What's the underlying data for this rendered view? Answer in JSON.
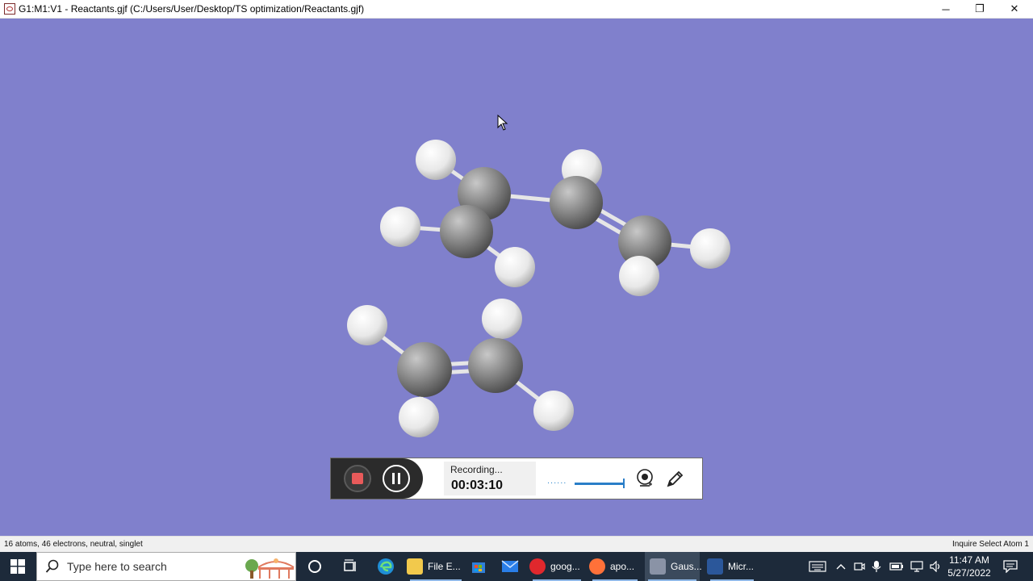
{
  "window": {
    "title": "G1:M1:V1 - Reactants.gjf (C:/Users/User/Desktop/TS optimization/Reactants.gjf)",
    "minimize_glyph": "─",
    "restore_glyph": "❐",
    "close_glyph": "✕"
  },
  "viewport": {
    "background_color": "#8080cc",
    "molecule_description_icons": [
      "carbon-atom",
      "hydrogen-atom",
      "single-bond",
      "double-bond"
    ]
  },
  "recorder": {
    "status": "Recording...",
    "elapsed": "00:03:10",
    "level_dots": "......",
    "stop_icon": "stop-icon",
    "pause_icon": "pause-icon",
    "webcam_icon": "webcam-icon",
    "pen_icon": "pen-icon"
  },
  "statusbar": {
    "info": "16 atoms, 46 electrons, neutral, singlet",
    "mode": "Inquire  Select Atom 1"
  },
  "taskbar": {
    "search_placeholder": "Type here to search",
    "apps": [
      {
        "label": "File E...",
        "icon": "folder-icon",
        "color": "#f2c94c"
      },
      {
        "label": "goog...",
        "icon": "opera-icon",
        "color": "#e0282d"
      },
      {
        "label": "apo...",
        "icon": "firefox-icon",
        "color": "#ff7139"
      },
      {
        "label": "Gaus...",
        "icon": "gaussview-icon",
        "color": "#8a93a6"
      },
      {
        "label": "Micr...",
        "icon": "word-icon",
        "color": "#2b579a"
      }
    ],
    "time": "11:47 AM",
    "date": "5/27/2022"
  }
}
